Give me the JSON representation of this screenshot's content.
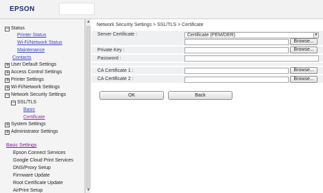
{
  "header": {
    "logo": "EPSON"
  },
  "sidebar": {
    "status": {
      "pm": "−",
      "label": "Status"
    },
    "printer_status": "Printer Status",
    "wifi_network_status": "Wi-Fi/Network Status",
    "maintenance": "Maintenance",
    "contacts": "Contacts",
    "user_default": {
      "pm": "+",
      "label": "User Default Settings"
    },
    "access_control": {
      "pm": "+",
      "label": "Access Control Settings"
    },
    "printer_settings": {
      "pm": "+",
      "label": "Printer Settings"
    },
    "wifi_network_settings": {
      "pm": "+",
      "label": "Wi-Fi/Network Settings"
    },
    "network_security": {
      "pm": "−",
      "label": "Network Security Settings"
    },
    "ssl_tls": {
      "pm": "−",
      "label": "SSL/TLS"
    },
    "basic": "Basic",
    "certificate": "Certificate",
    "system_settings": {
      "pm": "+",
      "label": "System Settings"
    },
    "administrator_settings": {
      "pm": "+",
      "label": "Administrator Settings"
    },
    "basic_settings_heading": "Basic Settings",
    "basic_settings_items": [
      "Epson Connect Services",
      "Google Cloud Print Services",
      "DNS/Proxy Setup",
      "Firmware Update",
      "Root Certificate Update",
      "AirPrint Setup"
    ]
  },
  "scrollbar": {
    "up": "▲",
    "down": "▼"
  },
  "main": {
    "breadcrumb": "Network Security Settings > SSL/TLS > Certificate",
    "server_certificate_label": "Server Certificate :",
    "server_certificate_value": "Certificate (PEM/DER)",
    "private_key_label": "Private Key :",
    "password_label": "Password :",
    "ca_certificate_1_label": "CA Certificate 1 :",
    "ca_certificate_2_label": "CA Certificate 2 :",
    "browse_label": "Browse...",
    "ok_label": "OK",
    "back_label": "Back"
  }
}
